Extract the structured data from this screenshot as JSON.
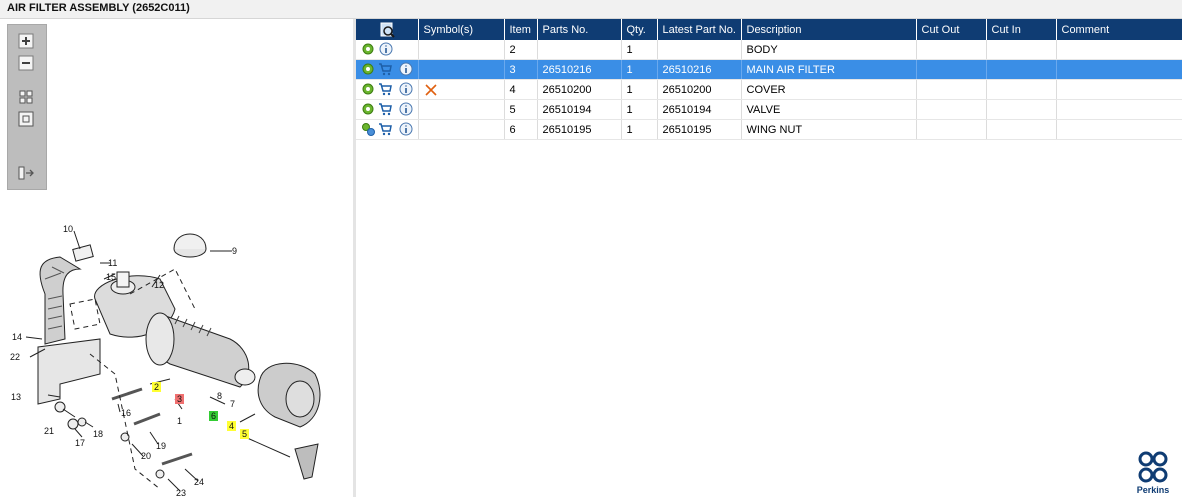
{
  "title": "AIR FILTER ASSEMBLY (2652C011)",
  "toolbar": {
    "zoom_in_icon": "plus-magnifier-icon",
    "zoom_out_icon": "minus-magnifier-icon",
    "fit_icon": "grid-icon",
    "reset_icon": "square-icon",
    "list_icon": "list-arrow-icon"
  },
  "table": {
    "headers": [
      "",
      "Symbol(s)",
      "Item",
      "Parts No.",
      "Qty.",
      "Latest Part No.",
      "Description",
      "Cut Out",
      "Cut In",
      "Comment"
    ],
    "rows": [
      {
        "item": "2",
        "part_no": "",
        "qty": "1",
        "latest": "",
        "description": "BODY",
        "cart": false,
        "gears": "single",
        "symbol": "",
        "selected": false
      },
      {
        "item": "3",
        "part_no": "26510216",
        "qty": "1",
        "latest": "26510216",
        "description": "MAIN AIR FILTER",
        "cart": true,
        "gears": "single",
        "symbol": "",
        "selected": true
      },
      {
        "item": "4",
        "part_no": "26510200",
        "qty": "1",
        "latest": "26510200",
        "description": "COVER",
        "cart": true,
        "gears": "single",
        "symbol": "x",
        "selected": false
      },
      {
        "item": "5",
        "part_no": "26510194",
        "qty": "1",
        "latest": "26510194",
        "description": "VALVE",
        "cart": true,
        "gears": "single",
        "symbol": "",
        "selected": false
      },
      {
        "item": "6",
        "part_no": "26510195",
        "qty": "1",
        "latest": "26510195",
        "description": "WING NUT",
        "cart": true,
        "gears": "double",
        "symbol": "",
        "selected": false
      }
    ]
  },
  "drawing": {
    "labels": [
      "10",
      "9",
      "11",
      "15",
      "12",
      "14",
      "22",
      "13",
      "2",
      "3",
      "8",
      "7",
      "16",
      "1",
      "6",
      "4",
      "5",
      "21",
      "18",
      "17",
      "19",
      "20",
      "24",
      "23"
    ]
  },
  "brand": {
    "name": "Perkins"
  },
  "colors": {
    "header": "#0f3c73",
    "selected": "#3a8ee6",
    "callout_yellow": "#ffff33",
    "callout_red": "#f07070",
    "callout_green": "#33cc33",
    "symbol_x": "#e06010"
  }
}
